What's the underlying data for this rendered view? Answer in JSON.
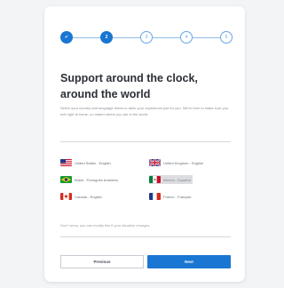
{
  "stepper": {
    "steps": [
      {
        "label": "✔",
        "state": "done"
      },
      {
        "label": "2",
        "state": "current"
      },
      {
        "label": "3",
        "state": "todo"
      },
      {
        "label": "4",
        "state": "todo"
      },
      {
        "label": "5",
        "state": "todo"
      }
    ]
  },
  "header": {
    "title_line1": "Support around the clock,",
    "title_line2": "around the world",
    "subtitle": "Select your country and language below to tailor your experience just for you. We're here to make sure you feel right at home, no matter where you are in the world."
  },
  "languages": [
    {
      "label": "United States - English",
      "flag": "us-flag",
      "selected": false
    },
    {
      "label": "United Kingdom - English",
      "flag": "uk-flag",
      "selected": false
    },
    {
      "label": "Brasil - Português brasileiro",
      "flag": "brazil-flag",
      "selected": false
    },
    {
      "label": "México - Español",
      "flag": "mexico-flag",
      "selected": true
    },
    {
      "label": "Canada - English",
      "flag": "canada-flag",
      "selected": false
    },
    {
      "label": "France - Français",
      "flag": "france-flag",
      "selected": false
    }
  ],
  "note": "Don't worry, you can modify this if your situation changes.",
  "buttons": {
    "previous": "Previous",
    "next": "Next"
  },
  "colors": {
    "accent": "#1976d2",
    "selected_bg": "#dcdde0"
  }
}
